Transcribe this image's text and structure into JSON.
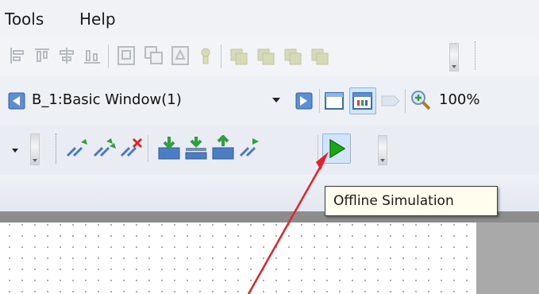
{
  "menu": {
    "tools": "Tools",
    "help": "Help"
  },
  "window_selector": {
    "value": "B_1:Basic Window(1)"
  },
  "zoom": {
    "value": "100%"
  },
  "tooltip": {
    "text": "Offline Simulation"
  },
  "colors": {
    "accent_green": "#18a818",
    "arrow": "#e8202a",
    "tooltip_bg": "#fffeee"
  },
  "icons": {
    "toolbar1": [
      "align-left-icon",
      "align-top-icon",
      "align-center-icon",
      "align-bottom-icon",
      "group-icon",
      "ungroup-icon",
      "bring-front-icon",
      "send-back-icon",
      "layer-icon",
      "layer-up-icon",
      "layer-down-icon",
      "layer-last-icon"
    ],
    "toolbar3": [
      "compile-icon",
      "compile-all-icon",
      "stop-compile-icon",
      "download-icon",
      "download-all-icon",
      "upload-icon",
      "transfer-icon",
      "offline-simulation-icon"
    ]
  }
}
